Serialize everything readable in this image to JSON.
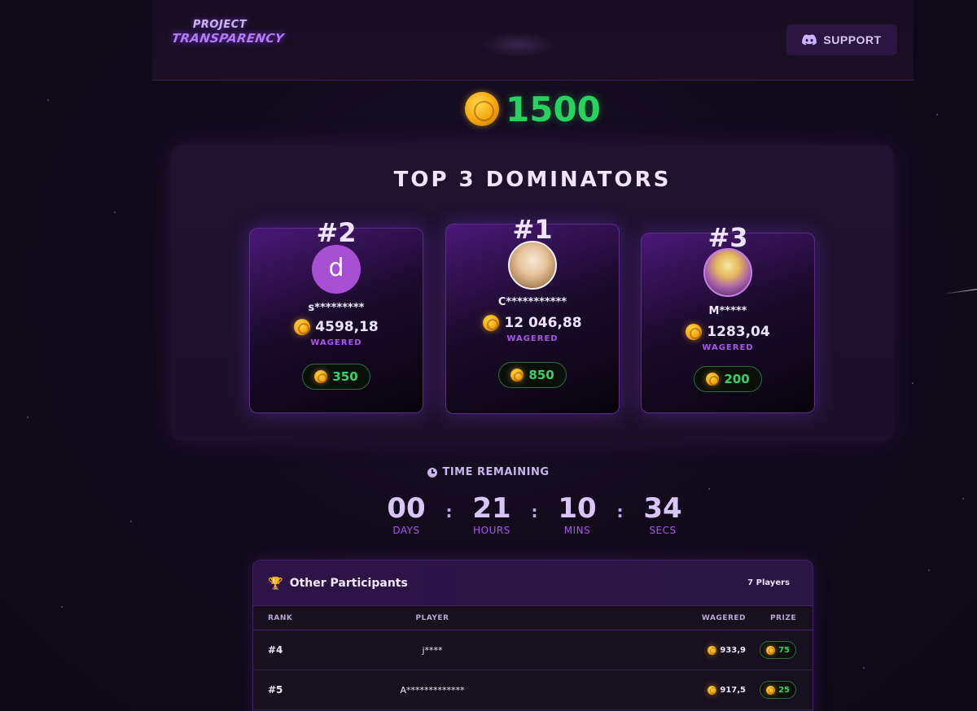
{
  "header": {
    "logo_line1": "PROJECT",
    "logo_line2": "TRANSPARENCY",
    "support_label": "SUPPORT",
    "support_icon": "discord-icon"
  },
  "prize_pool": {
    "amount": "1500",
    "icon": "coin-icon"
  },
  "podium": {
    "title": "TOP 3 DOMINATORS",
    "wagered_label": "WAGERED",
    "cards": [
      {
        "rank": "#2",
        "avatar_letter": "d",
        "player": "s*********",
        "wagered": "4598,18",
        "prize": "350"
      },
      {
        "rank": "#1",
        "avatar_letter": "",
        "player": "C***********",
        "wagered": "12 046,88",
        "prize": "850"
      },
      {
        "rank": "#3",
        "avatar_letter": "",
        "player": "M*****",
        "wagered": "1283,04",
        "prize": "200"
      }
    ]
  },
  "timer": {
    "label": "TIME REMAINING",
    "days": "00",
    "days_label": "DAYS",
    "hours": "21",
    "hours_label": "HOURS",
    "mins": "10",
    "mins_label": "MINS",
    "secs": "34",
    "secs_label": "SECS",
    "separator": ":"
  },
  "participants": {
    "title": "Other Participants",
    "count": "7 Players",
    "columns": {
      "rank": "RANK",
      "player": "PLAYER",
      "wagered": "WAGERED",
      "prize": "PRIZE"
    },
    "rows": [
      {
        "rank": "#4",
        "player": "j****",
        "wagered": "933,9",
        "prize": "75"
      },
      {
        "rank": "#5",
        "player": "A*************",
        "wagered": "917,5",
        "prize": "25"
      }
    ]
  },
  "colors": {
    "accent_purple": "#a657e8",
    "prize_green": "#27d35f",
    "background": "#120b1c"
  }
}
